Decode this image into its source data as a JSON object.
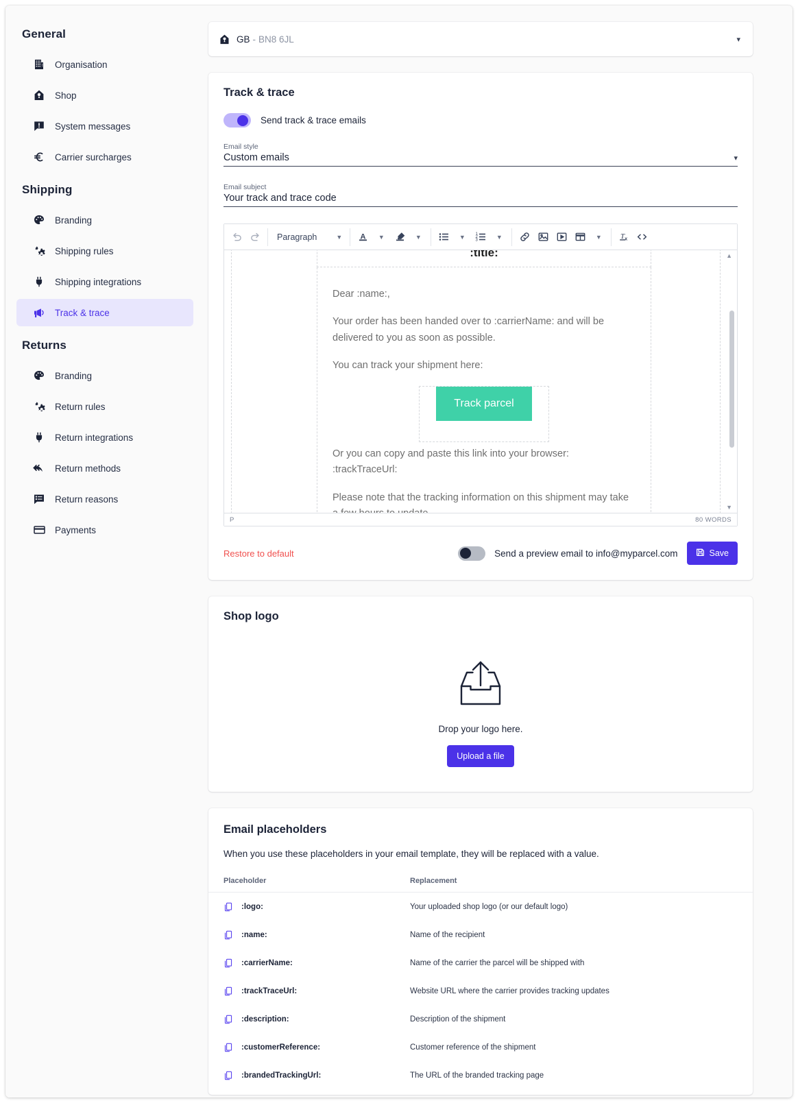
{
  "sidebar": {
    "groups": [
      {
        "title": "General",
        "items": [
          {
            "label": "Organisation",
            "icon": "building-icon"
          },
          {
            "label": "Shop",
            "icon": "home-icon"
          },
          {
            "label": "System messages",
            "icon": "message-alert-icon"
          },
          {
            "label": "Carrier surcharges",
            "icon": "euro-icon"
          }
        ]
      },
      {
        "title": "Shipping",
        "items": [
          {
            "label": "Branding",
            "icon": "palette-icon"
          },
          {
            "label": "Shipping rules",
            "icon": "gear-icon"
          },
          {
            "label": "Shipping integrations",
            "icon": "plug-icon"
          },
          {
            "label": "Track & trace",
            "icon": "megaphone-icon",
            "active": true
          }
        ]
      },
      {
        "title": "Returns",
        "items": [
          {
            "label": "Branding",
            "icon": "palette-icon"
          },
          {
            "label": "Return rules",
            "icon": "gear-icon"
          },
          {
            "label": "Return integrations",
            "icon": "plug-icon"
          },
          {
            "label": "Return methods",
            "icon": "reply-all-icon"
          },
          {
            "label": "Return reasons",
            "icon": "comment-list-icon"
          },
          {
            "label": "Payments",
            "icon": "credit-card-icon"
          }
        ]
      }
    ]
  },
  "shop_selector": {
    "icon": "home-icon",
    "country": "GB",
    "separator": "-",
    "postcode": "BN8 6JL",
    "caret": "▾"
  },
  "track_trace": {
    "title": "Track & trace",
    "toggle_label": "Send track & trace emails",
    "toggle_state": "on",
    "email_style": {
      "label": "Email style",
      "value": "Custom emails",
      "caret": "▾"
    },
    "email_subject": {
      "label": "Email subject",
      "value": "Your track and trace code"
    },
    "toolbar": {
      "undo": "undo-icon",
      "redo": "redo-icon",
      "block_format": "Paragraph",
      "text_color": "text-color-icon",
      "highlight_color": "highlight-color-icon",
      "bullet_list": "bullet-list-icon",
      "numbered_list": "numbered-list-icon",
      "link": "link-icon",
      "image": "image-icon",
      "video": "video-icon",
      "table": "table-icon",
      "clear_formatting": "clear-formatting-icon",
      "source_code": "source-code-icon"
    },
    "editor": {
      "title_placeholder": ":title:",
      "paragraphs": [
        "Dear :name:,",
        "Your order has been handed over to :carrierName: and will be delivered to you as soon as possible.",
        "You can track your shipment here:"
      ],
      "cta_label": "Track parcel",
      "cta_color": "#3fd1a8",
      "paragraphs_after": [
        "Or you can copy and paste this link into your browser: :trackTraceUrl:",
        "Please note that the tracking information on this shipment may take a few hours to update."
      ],
      "status_path": "P",
      "word_count": "80 WORDS"
    },
    "restore_label": "Restore to default",
    "preview_toggle_label": "Send a preview email to info@myparcel.com",
    "preview_toggle_state": "off",
    "save_label": "Save",
    "save_icon": "save-icon"
  },
  "shop_logo": {
    "title": "Shop logo",
    "upload_icon": "upload-tray-icon",
    "drop_text": "Drop your logo here.",
    "upload_button": "Upload a file"
  },
  "email_placeholders": {
    "title": "Email placeholders",
    "intro": "When you use these placeholders in your email template, they will be replaced with a value.",
    "columns": [
      "Placeholder",
      "Replacement"
    ],
    "rows": [
      {
        "icon": "copy-icon",
        "placeholder": ":logo:",
        "replacement": "Your uploaded shop logo (or our default logo)"
      },
      {
        "icon": "copy-icon",
        "placeholder": ":name:",
        "replacement": "Name of the recipient"
      },
      {
        "icon": "copy-icon",
        "placeholder": ":carrierName:",
        "replacement": "Name of the carrier the parcel will be shipped with"
      },
      {
        "icon": "copy-icon",
        "placeholder": ":trackTraceUrl:",
        "replacement": "Website URL where the carrier provides tracking updates"
      },
      {
        "icon": "copy-icon",
        "placeholder": ":description:",
        "replacement": "Description of the shipment"
      },
      {
        "icon": "copy-icon",
        "placeholder": ":customerReference:",
        "replacement": "Customer reference of the shipment"
      },
      {
        "icon": "copy-icon",
        "placeholder": ":brandedTrackingUrl:",
        "replacement": "The URL of the branded tracking page"
      }
    ]
  },
  "colors": {
    "accent": "#4b32e8",
    "accent_soft": "#e8e6fd",
    "danger": "#f0514f",
    "cta_green": "#3fd1a8",
    "text": "#1c2337"
  }
}
